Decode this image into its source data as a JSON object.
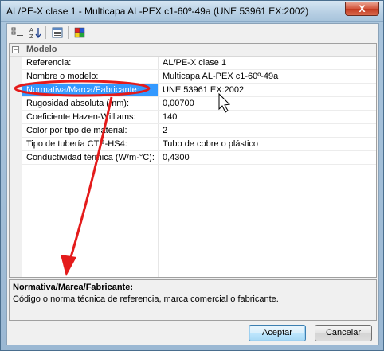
{
  "window": {
    "title": "AL/PE-X clase 1 - Multicapa AL-PEX c1-60º-49a (UNE 53961 EX:2002)",
    "close_label": "X"
  },
  "toolbar": {
    "buttons": [
      "categorized-icon",
      "alphabetical-icon",
      "property-pages-icon",
      "color-icon"
    ],
    "alpha_glyph": "A↓Z"
  },
  "grid": {
    "category": {
      "label": "Modelo",
      "expander": "−"
    },
    "rows": [
      {
        "name": "Referencia:",
        "value": "AL/PE-X clase 1"
      },
      {
        "name": "Nombre o modelo:",
        "value": "Multicapa AL-PEX c1-60º-49a"
      },
      {
        "name": "Normativa/Marca/Fabricante:",
        "value": "UNE 53961 EX:2002"
      },
      {
        "name": "Rugosidad absoluta (mm):",
        "value": "0,00700"
      },
      {
        "name": "Coeficiente Hazen-Williams:",
        "value": "140"
      },
      {
        "name": "Color por tipo de material:",
        "value": "2"
      },
      {
        "name": "Tipo de tubería CTE-HS4:",
        "value": "Tubo de cobre o plástico"
      },
      {
        "name": "Conductividad térmica (W/m·°C):",
        "value": "0,4300"
      }
    ]
  },
  "description": {
    "title": "Normativa/Marca/Fabricante:",
    "text": "Código o norma técnica de referencia, marca comercial o fabricante."
  },
  "buttons": {
    "accept": "Aceptar",
    "cancel": "Cancelar"
  },
  "colors": {
    "selection": "#3399ff",
    "annotation": "#e41b1b"
  }
}
